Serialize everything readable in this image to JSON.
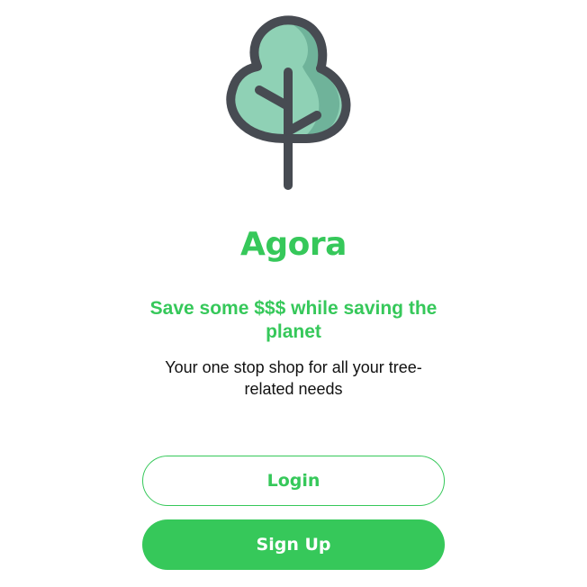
{
  "app": {
    "name": "Agora",
    "tagline": "Save some $$$ while saving the planet",
    "subtitle": "Your one stop shop for all your tree-related needs"
  },
  "buttons": {
    "login_label": "Login",
    "signup_label": "Sign Up"
  },
  "icons": {
    "logo": "tree-icon"
  },
  "colors": {
    "brand_green": "#36c85a",
    "tree_fill": "#8fd1b5",
    "tree_shade": "#6fb39a",
    "tree_outline": "#474b52",
    "text_dark": "#111111"
  }
}
